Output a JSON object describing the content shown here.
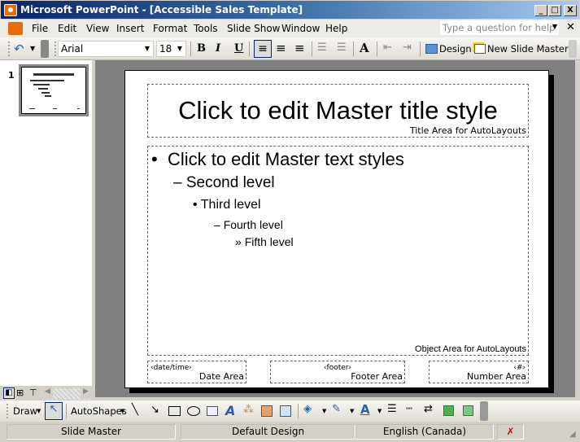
{
  "window": {
    "title": "Microsoft PowerPoint - [Accessible Sales Template]",
    "minimize": "_",
    "maximize": "□",
    "close": "X"
  },
  "menu": {
    "items": [
      {
        "label": "File",
        "accel": "F"
      },
      {
        "label": "Edit",
        "accel": "E"
      },
      {
        "label": "View",
        "accel": "V"
      },
      {
        "label": "Insert",
        "accel": "I"
      },
      {
        "label": "Format",
        "accel": "o"
      },
      {
        "label": "Tools",
        "accel": "T"
      },
      {
        "label": "Slide Show",
        "accel": "d"
      },
      {
        "label": "Window",
        "accel": "W"
      },
      {
        "label": "Help",
        "accel": "H"
      }
    ],
    "help_placeholder": "Type a question for help",
    "close_doc": "✕"
  },
  "toolbar": {
    "font": "Arial",
    "size": "18",
    "bold": "B",
    "italic": "I",
    "underline": "U",
    "design_label": "Design",
    "new_master_label": "New Slide Master"
  },
  "thumbnail": {
    "number": "1"
  },
  "slide": {
    "title": "Click to edit Master title style",
    "title_area_label": "Title Area for AutoLayouts",
    "levels": [
      {
        "bullet": "•",
        "text": "Click to edit Master text styles"
      },
      {
        "bullet": "–",
        "text": "Second level"
      },
      {
        "bullet": "•",
        "text": "Third level"
      },
      {
        "bullet": "–",
        "text": "Fourth level"
      },
      {
        "bullet": "»",
        "text": "Fifth level"
      }
    ],
    "object_area_label": "Object Area for AutoLayouts",
    "date_field": "‹date/time›",
    "date_label": "Date Area",
    "footer_field": "‹footer›",
    "footer_label": "Footer Area",
    "number_field": "‹#›",
    "number_label": "Number Area"
  },
  "drawbar": {
    "draw_label": "Draw",
    "autoshapes_label": "AutoShapes"
  },
  "status": {
    "view": "Slide Master",
    "design": "Default Design",
    "language": "English (Canada)"
  }
}
